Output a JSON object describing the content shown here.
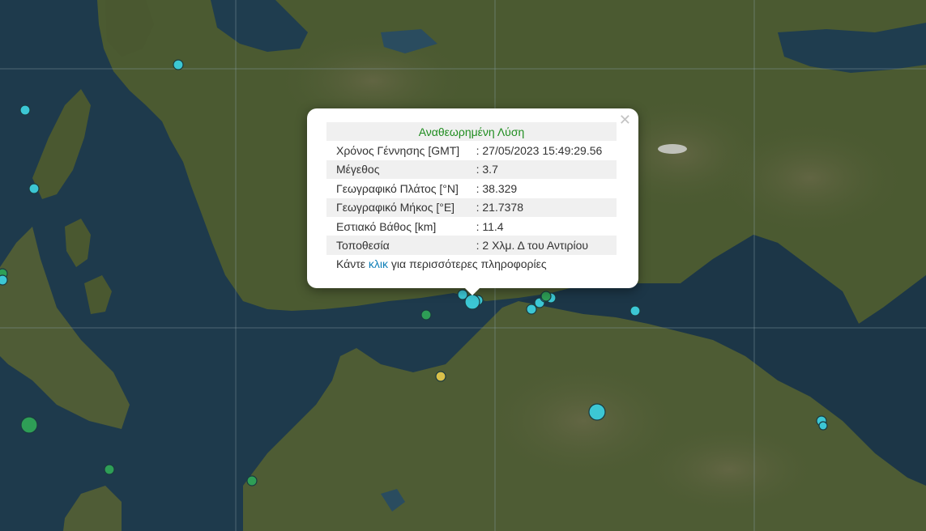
{
  "popup": {
    "title": "Αναθεωρημένη Λύση",
    "close_icon": "close-icon",
    "rows": [
      {
        "label": "Χρόνος Γέννησης [GMT]",
        "value": ": 27/05/2023 15:49:29.56"
      },
      {
        "label": "Μέγεθος",
        "value": ": 3.7"
      },
      {
        "label": "Γεωγραφικό Πλάτος [°N]",
        "value": ": 38.329"
      },
      {
        "label": "Γεωγραφικό Μήκος [°E]",
        "value": ": 21.7378"
      },
      {
        "label": "Εστιακό Βάθος [km]",
        "value": ": 11.4"
      },
      {
        "label": "Τοποθεσία",
        "value": ": 2 Χλμ. Δ του Αντιρίου"
      }
    ],
    "more_prefix": "Κάντε ",
    "more_link": "κλικ",
    "more_suffix": " για περισσότερες πληροφορίες"
  },
  "colors": {
    "sea": "#1e3a4c",
    "land": "#4c5a32",
    "marker_cyan": "#3cc7d4",
    "marker_green": "#2e9e56",
    "marker_yellow": "#d8c04a",
    "title_green": "#1f8c1f",
    "link_blue": "#0e7fb8"
  }
}
